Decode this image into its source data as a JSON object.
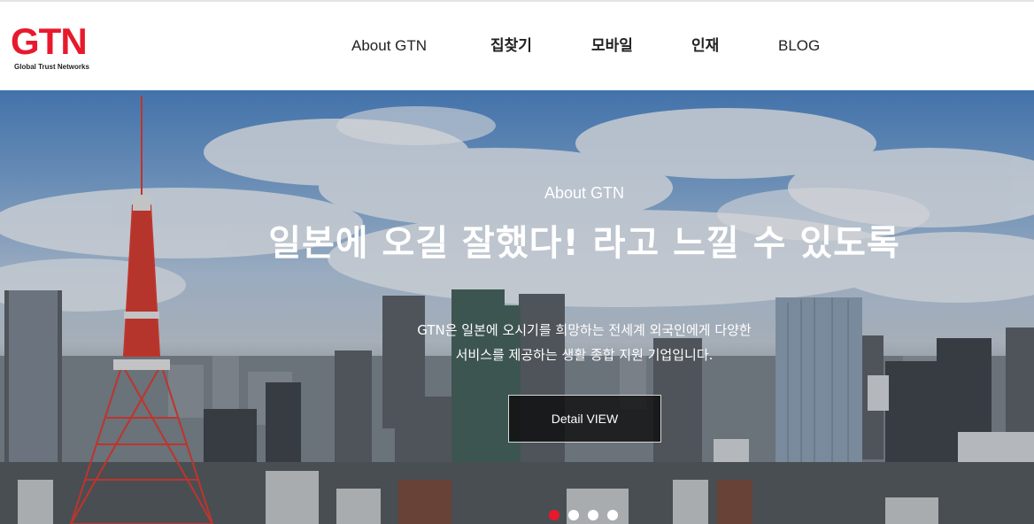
{
  "brand": {
    "name": "GTN",
    "tagline": "Global Trust Networks",
    "color": "#e8192c"
  },
  "nav": {
    "items": [
      {
        "label": "About GTN"
      },
      {
        "label": "집찾기"
      },
      {
        "label": "모바일"
      },
      {
        "label": "인재"
      },
      {
        "label": "BLOG"
      }
    ]
  },
  "hero": {
    "subtitle": "About GTN",
    "title": "일본에 오길 잘했다! 라고 느낄 수 있도록",
    "description_lines": [
      "GTN은 일본에 오시기를 희망하는 전세계 외국인에게 다양한",
      "서비스를 제공하는 생활 종합 지원 기업입니다."
    ],
    "button_label": "Detail VIEW"
  },
  "slider": {
    "count": 4,
    "active": 0,
    "active_color": "#e8192c"
  }
}
